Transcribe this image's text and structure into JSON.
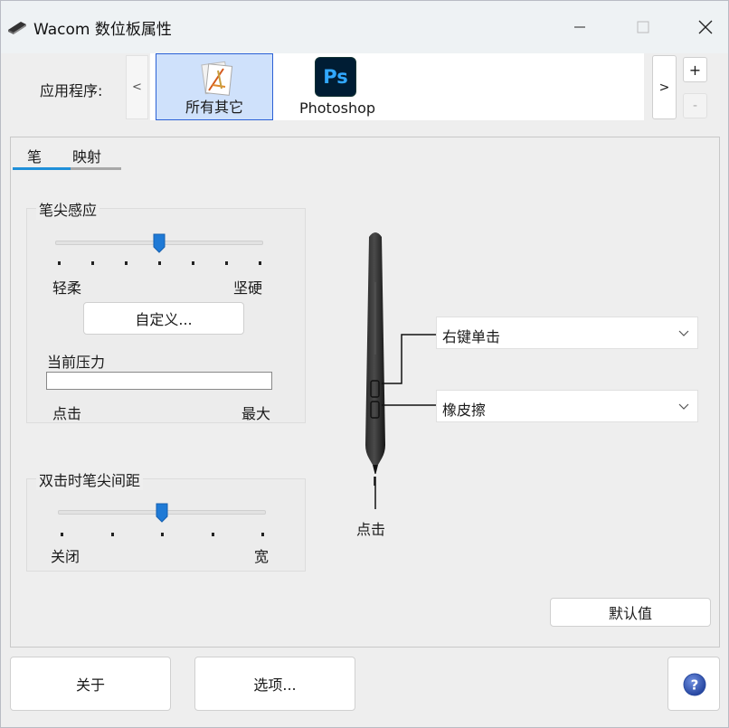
{
  "window": {
    "title": "Wacom 数位板属性",
    "minimize_icon": "minimize-icon",
    "maximize_icon": "maximize-icon",
    "close_icon": "close-icon"
  },
  "applications": {
    "label": "应用程序:",
    "prev_label": "<",
    "next_label": ">",
    "add_label": "+",
    "remove_label": "-",
    "items": [
      {
        "label": "所有其它",
        "selected": true,
        "icon": "all-apps-icon"
      },
      {
        "label": "Photoshop",
        "selected": false,
        "icon": "photoshop-icon",
        "icon_text": "Ps"
      }
    ]
  },
  "tabs": [
    {
      "label": "笔",
      "active": true
    },
    {
      "label": "映射",
      "active": false
    }
  ],
  "tip_feel": {
    "title": "笔尖感应",
    "min_label": "轻柔",
    "max_label": "坚硬",
    "level": 0.5,
    "tick_count": 7,
    "customize_label": "自定义...",
    "current_pressure_label": "当前压力",
    "pressure_value": 0,
    "pressure_min_label": "点击",
    "pressure_max_label": "最大"
  },
  "double_click": {
    "title": "双击时笔尖间距",
    "min_label": "关闭",
    "max_label": "宽",
    "level": 0.5,
    "tick_count": 5
  },
  "pen": {
    "upper_button": "右键单击",
    "lower_button": "橡皮擦",
    "tip": "点击"
  },
  "buttons": {
    "default": "默认值",
    "about": "关于",
    "options": "选项...",
    "help_icon": "help-icon"
  },
  "colors": {
    "accent": "#1f8fd9",
    "selection": "#cfe1fb",
    "selection_border": "#2b61d6"
  }
}
